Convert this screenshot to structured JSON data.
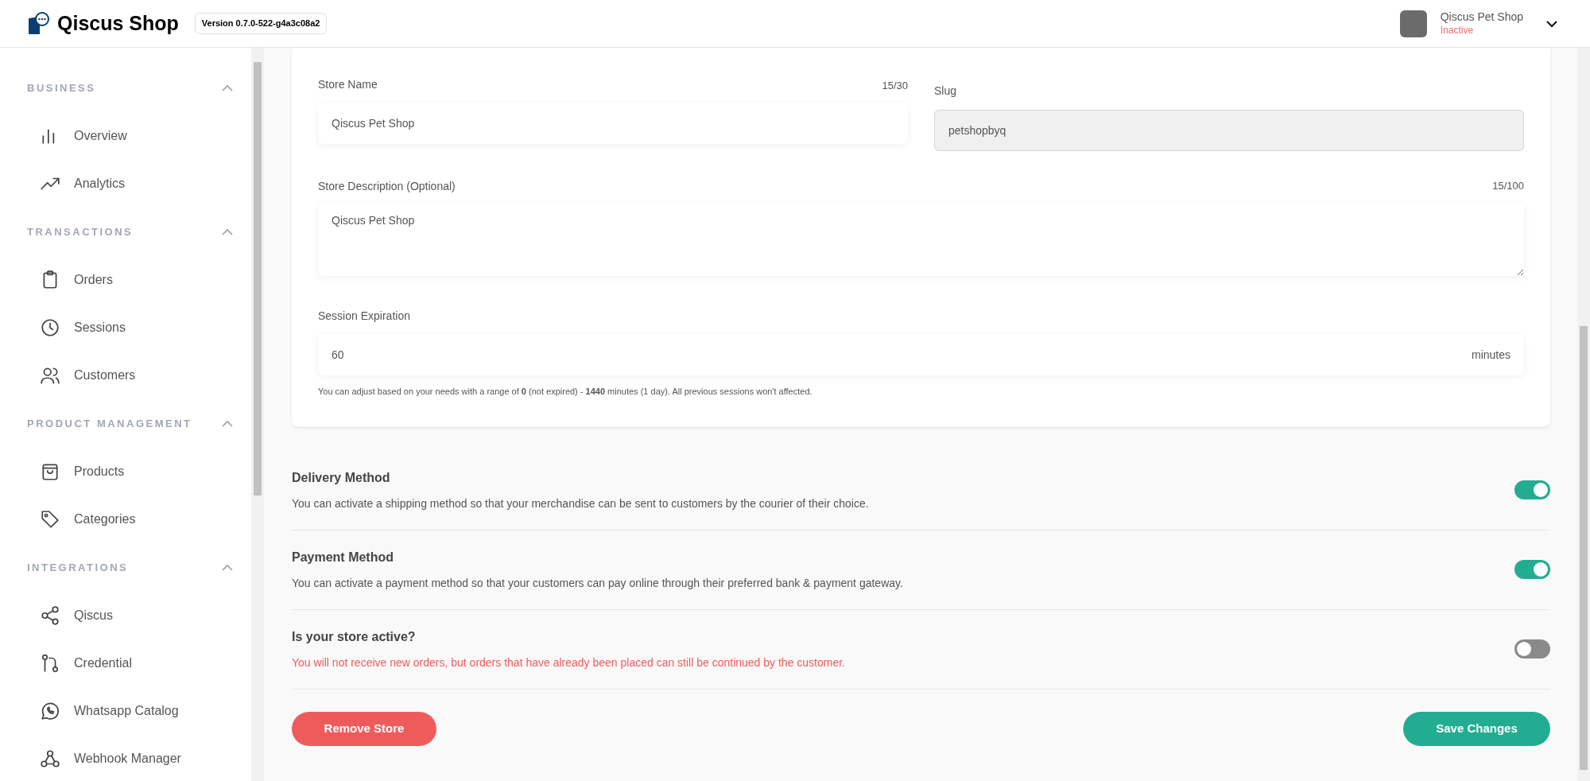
{
  "header": {
    "brand": "Qiscus Shop",
    "version": "Version 0.7.0-522-g4a3c08a2",
    "store_name": "Qiscus Pet Shop",
    "store_status": "Inactive"
  },
  "sidebar": {
    "sections": [
      {
        "title": "BUSINESS",
        "expanded": true,
        "items": [
          {
            "label": "Overview",
            "kind": "bars"
          },
          {
            "label": "Analytics",
            "kind": "trend"
          }
        ]
      },
      {
        "title": "TRANSACTIONS",
        "expanded": true,
        "items": [
          {
            "label": "Orders",
            "kind": "clipboard"
          },
          {
            "label": "Sessions",
            "kind": "clock"
          },
          {
            "label": "Customers",
            "kind": "users"
          }
        ]
      },
      {
        "title": "PRODUCT MANAGEMENT",
        "expanded": true,
        "items": [
          {
            "label": "Products",
            "kind": "bag"
          },
          {
            "label": "Categories",
            "kind": "tag"
          }
        ]
      },
      {
        "title": "INTEGRATIONS",
        "expanded": true,
        "items": [
          {
            "label": "Qiscus",
            "kind": "share"
          },
          {
            "label": "Credential",
            "kind": "git"
          },
          {
            "label": "Whatsapp Catalog",
            "kind": "whatsapp"
          },
          {
            "label": "Webhook Manager",
            "kind": "webhook"
          }
        ]
      }
    ]
  },
  "form": {
    "store_name": {
      "label": "Store Name",
      "counter": "15/30",
      "value": "Qiscus Pet Shop"
    },
    "slug": {
      "label": "Slug",
      "value": "petshopbyq",
      "disabled": true
    },
    "description": {
      "label": "Store Description (Optional)",
      "counter": "15/100",
      "value": "Qiscus Pet Shop"
    },
    "session": {
      "label": "Session Expiration",
      "value": "60",
      "unit": "minutes",
      "hint": "You can adjust based on your needs with a range of **0** (not expired) - **1440** minutes (1 day). All previous sessions won't affected."
    }
  },
  "settings": [
    {
      "title": "Delivery Method",
      "description": "You can activate a shipping method so that your merchandise can be sent to customers by the courier of their choice.",
      "on": true,
      "warning": false
    },
    {
      "title": "Payment Method",
      "description": "You can activate a payment method so that your customers can pay online through their preferred bank & payment gateway.",
      "on": true,
      "warning": false
    },
    {
      "title": "Is your store active?",
      "description": "You will not receive new orders, but orders that have already been placed can still be continued by the customer.",
      "on": false,
      "warning": true
    }
  ],
  "actions": {
    "remove": "Remove Store",
    "save": "Save Changes"
  }
}
